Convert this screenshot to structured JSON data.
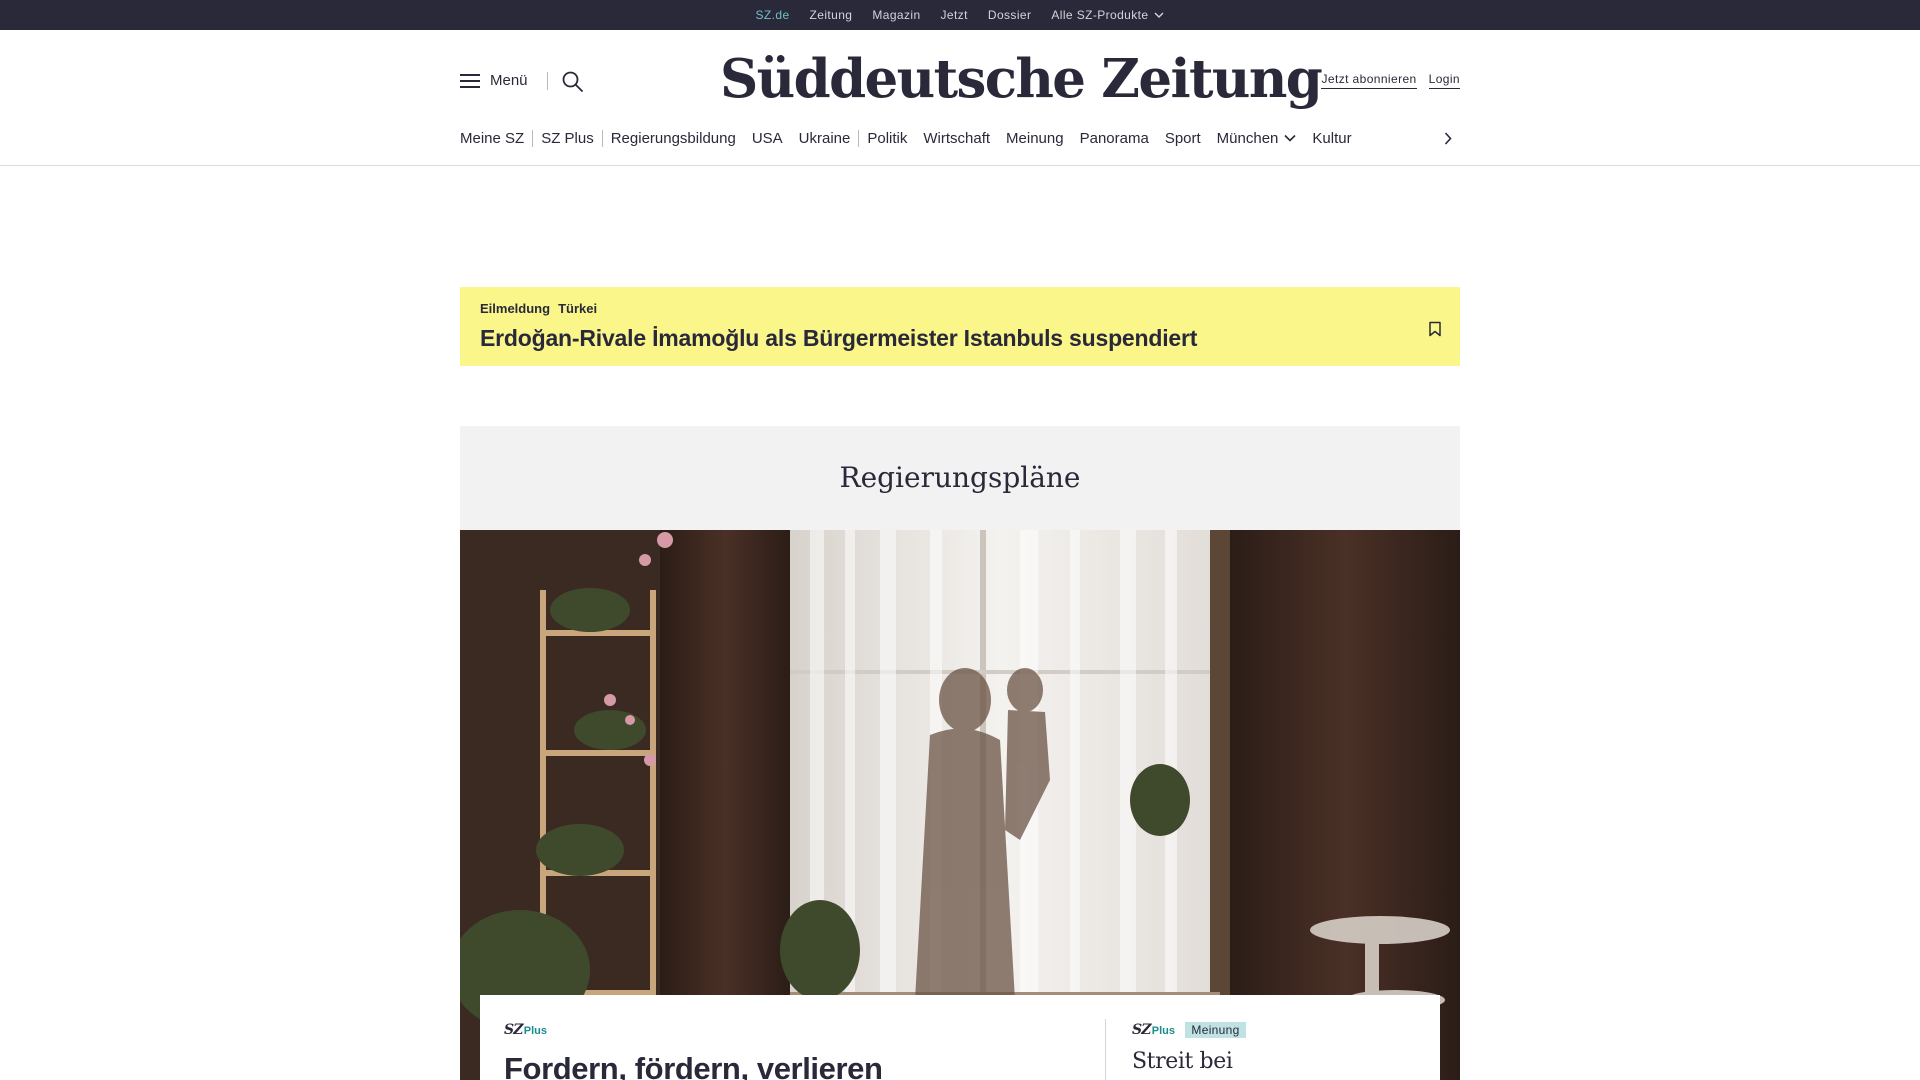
{
  "topbar": {
    "items": [
      {
        "label": "SZ.de",
        "active": true
      },
      {
        "label": "Zeitung"
      },
      {
        "label": "Magazin"
      },
      {
        "label": "Jetzt"
      },
      {
        "label": "Dossier"
      },
      {
        "label": "Alle SZ-Produkte",
        "has_dropdown": true
      }
    ]
  },
  "header": {
    "menu_label": "Menü",
    "logo": "Süddeutsche Zeitung",
    "subscribe_label": "Jetzt abonnieren",
    "login_label": "Login"
  },
  "nav": {
    "items": [
      {
        "label": "Meine SZ"
      },
      {
        "label": "SZ Plus"
      },
      {
        "label": "Regierungsbildung"
      },
      {
        "label": "USA"
      },
      {
        "label": "Ukraine"
      },
      {
        "label": "Politik"
      },
      {
        "label": "Wirtschaft"
      },
      {
        "label": "Meinung"
      },
      {
        "label": "Panorama"
      },
      {
        "label": "Sport"
      },
      {
        "label": "München",
        "has_dropdown": true
      },
      {
        "label": "Kultur"
      }
    ]
  },
  "breaking": {
    "kicker": "Eilmeldung",
    "topic": "Türkei",
    "title": "Erdoğan-Rivale İmamoğlu als Bürgermeister Istanbuls suspendiert"
  },
  "section": {
    "title": "Regierungspläne"
  },
  "cards": {
    "main": {
      "badge_sz": "SZ",
      "badge_plus": "Plus",
      "title": "Fordern, fördern, verlieren"
    },
    "side": {
      "badge_sz": "SZ",
      "badge_plus": "Plus",
      "tag": "Meinung",
      "title": "Streit bei Koalitionsverhandlungen"
    }
  },
  "colors": {
    "topbar_bg": "#29293a",
    "active_link": "#71c0c6",
    "breaking_bg": "#fbf68a",
    "section_bg": "#f2f2f2",
    "plus_accent": "#1b8c8e",
    "opinion_tag_bg": "#bfe3e2"
  },
  "icons": {
    "menu": "hamburger-icon",
    "search": "search-icon",
    "bookmark": "bookmark-icon",
    "dropdown": "chevron-down-icon",
    "nav_next": "chevron-right-icon"
  }
}
